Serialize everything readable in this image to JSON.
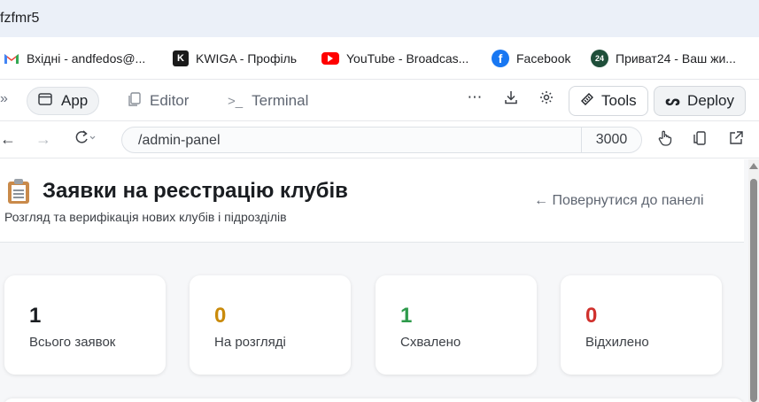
{
  "window": {
    "tab_title": "fzfmr5"
  },
  "bookmarks": [
    {
      "label": "Вхідні - andfedos@...",
      "icon": "gmail-icon"
    },
    {
      "label": "KWIGA - Профіль",
      "icon": "kwiga-icon"
    },
    {
      "label": "YouTube - Broadcas...",
      "icon": "youtube-icon"
    },
    {
      "label": "Facebook",
      "icon": "facebook-icon"
    },
    {
      "label": "Приват24 - Ваш жи...",
      "icon": "privat24-icon",
      "icon_text": "24"
    }
  ],
  "toolbar": {
    "tabs": [
      {
        "label": "App",
        "icon": "window-icon",
        "active": true
      },
      {
        "label": "Editor",
        "icon": "file-icon",
        "active": false
      },
      {
        "label": "Terminal",
        "icon": "terminal-icon",
        "active": false
      }
    ],
    "tools_label": "Tools",
    "deploy_label": "Deploy"
  },
  "address": {
    "url": "/admin-panel",
    "port": "3000"
  },
  "page": {
    "title": "Заявки на реєстрацію клубів",
    "subtitle": "Розгляд та верифікація нових клубів і підрозділів",
    "back_link": "← Повернутися до панелі",
    "stats": [
      {
        "value": "1",
        "label": "Всього заявок",
        "color": "#1a1d21"
      },
      {
        "value": "0",
        "label": "На розгляді",
        "color": "#c98a0a"
      },
      {
        "value": "1",
        "label": "Схвалено",
        "color": "#2e9a4b"
      },
      {
        "value": "0",
        "label": "Відхилено",
        "color": "#d0312d"
      }
    ]
  },
  "colors": {
    "accent": "#1a1d21",
    "pending": "#c98a0a",
    "approved": "#2e9a4b",
    "rejected": "#d0312d"
  }
}
